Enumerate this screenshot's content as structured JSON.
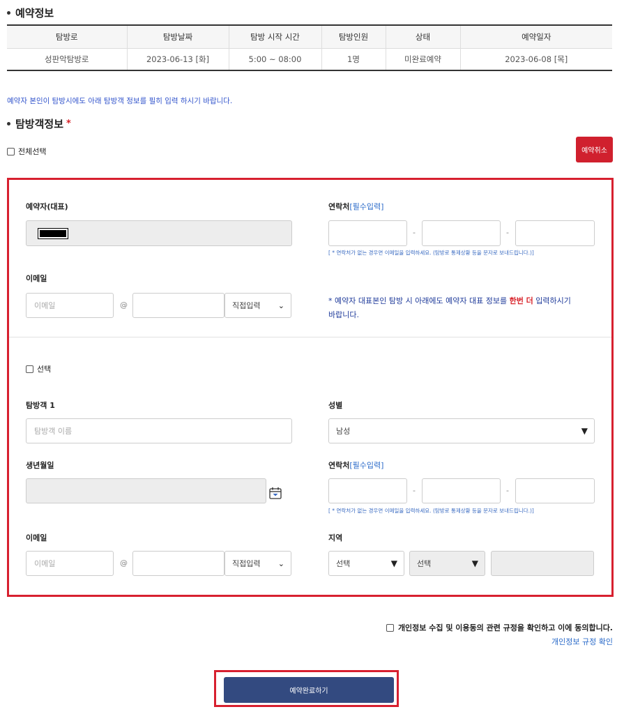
{
  "reservation": {
    "title": "예약정보",
    "headers": [
      "탐방로",
      "탐방날짜",
      "탐방 시작 시간",
      "탐방인원",
      "상태",
      "예약일자"
    ],
    "row": [
      "성판악탐방로",
      "2023-06-13 [화]",
      "5:00 ~ 08:00",
      "1명",
      "미완료예약",
      "2023-06-08 [목]"
    ]
  },
  "notice": "예약자 본인이 탐방시에도 아래 탐방객 정보를 필히 입력 하시기 바랍니다.",
  "visitor_section": {
    "title": "탐방객정보",
    "required_mark": "*",
    "select_all_label": "전체선택",
    "cancel_button": "예약취소"
  },
  "representative": {
    "name_label": "예약자(대표)",
    "contact_label": "연락처",
    "contact_required": "[필수입력]",
    "dash": "-",
    "contact_help": "[ * 연락처가 없는 경우면 이메일을 입력하세요. (탐방로 통제상황 등을 문자로 보내드립니다.)]",
    "email_label": "이메일",
    "email_placeholder": "이메일",
    "at": "@",
    "domain_select": "직접입력",
    "note_prefix": "* 예약자 대표본인 탐방 시 아래에도 예약자 대표 정보를 ",
    "note_emphasis": "한번 더",
    "note_suffix": " 입력하시기 바랍니다."
  },
  "visitor1": {
    "select_label": "선택",
    "name_label": "탐방객 1",
    "name_placeholder": "탐방객 이름",
    "gender_label": "성별",
    "gender_value": "남성",
    "birth_label": "생년월일",
    "contact_label": "연락처",
    "contact_required": "[필수입력]",
    "dash": "-",
    "contact_help": "[ * 연락처가 없는 경우면 이메일을 입력하세요. (탐방로 통제상황 등을 문자로 보내드립니다.)]",
    "email_label": "이메일",
    "email_placeholder": "이메일",
    "at": "@",
    "domain_select": "직접입력",
    "region_label": "지역",
    "region1": "선택",
    "region2": "선택"
  },
  "agreement": {
    "text": "개인정보 수집 및 이용동의 관련 규정을 확인하고 이에 동의합니다.",
    "link": "개인정보 규정 확인"
  },
  "submit_button": "예약완료하기",
  "colors": {
    "accent_red": "#d7202f",
    "submit_blue": "#334a80",
    "link_blue": "#2a6ac9"
  }
}
